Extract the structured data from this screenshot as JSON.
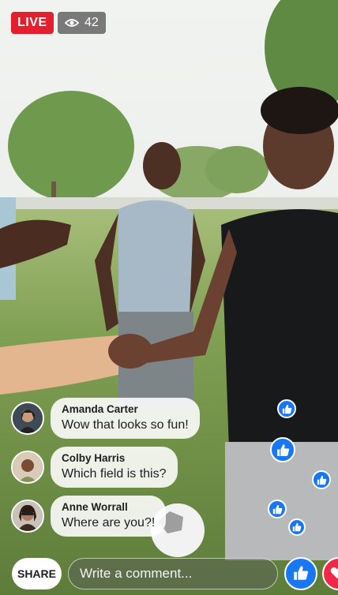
{
  "live": {
    "label": "LIVE",
    "viewer_count": "42"
  },
  "comments": [
    {
      "name": "Amanda Carter",
      "text": "Wow that looks so fun!"
    },
    {
      "name": "Colby Harris",
      "text": "Which field is this?"
    },
    {
      "name": "Anne Worrall",
      "text": "Where are you?!"
    }
  ],
  "bottom_bar": {
    "share_label": "SHARE",
    "comment_placeholder": "Write a comment..."
  },
  "colors": {
    "live_red": "#e4202e",
    "like_blue": "#1877f2",
    "love_red": "#f0284a"
  },
  "icons": {
    "viewers": "eye-icon",
    "like": "thumbs-up-icon",
    "love": "heart-icon"
  }
}
